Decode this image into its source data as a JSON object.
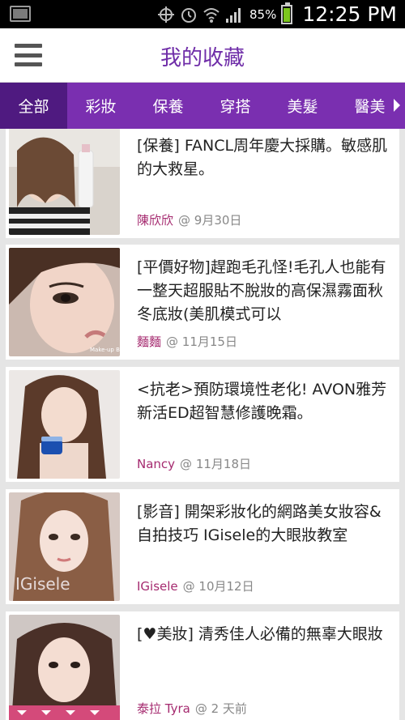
{
  "status_bar": {
    "battery_pct": "85%",
    "battery_level": 0.85,
    "time": "12:25 PM",
    "icons": [
      "image-icon",
      "target-icon",
      "alarm-icon",
      "wifi-icon",
      "signal-icon",
      "battery-icon"
    ]
  },
  "app_bar": {
    "title": "我的收藏",
    "menu_icon": "hamburger-menu-icon"
  },
  "tabs": [
    {
      "label": "全部",
      "active": true
    },
    {
      "label": "彩妝",
      "active": false
    },
    {
      "label": "保養",
      "active": false
    },
    {
      "label": "穿搭",
      "active": false
    },
    {
      "label": "美髮",
      "active": false
    },
    {
      "label": "醫美",
      "active": false
    }
  ],
  "items": [
    {
      "title": "[保養] FANCL周年慶大採購。敏感肌的大救星。",
      "author": "陳欣欣",
      "date": "@ 9月30日"
    },
    {
      "title": "[平價好物]趕跑毛孔怪!毛孔人也能有一整天超服貼不脫妝的高保濕霧面秋冬底妝(美肌模式可以",
      "author": "麵麵",
      "date": "@ 11月15日"
    },
    {
      "title": "<抗老>預防環境性老化! AVON雅芳新活ED超智慧修護晚霜。",
      "author": "Nancy",
      "date": "@ 11月18日"
    },
    {
      "title": "[影音] 開架彩妝化的網路美女妝容&自拍技巧 IGisele的大眼妝教室",
      "author": "IGisele",
      "date": "@ 10月12日"
    },
    {
      "title": "[♥美妝] 清秀佳人必備的無辜大眼妝",
      "author": "泰拉 Tyra",
      "date": "@ 2 天前"
    }
  ],
  "thumb_watermarks": {
    "item_2": "Make-up Beauty",
    "item_4": "IGisele"
  },
  "colors": {
    "brand_purple": "#7a2fb0",
    "active_tab": "#4f1a80",
    "author": "#a52a6f"
  }
}
